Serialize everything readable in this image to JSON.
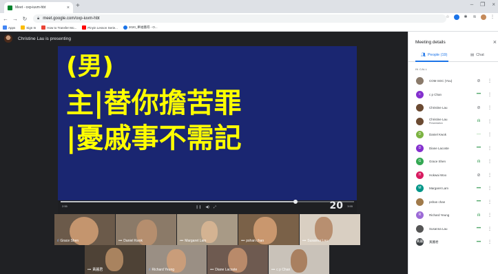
{
  "browser": {
    "tab_title": "Meet - oxp-iuvm-hbt",
    "tab_close": "×",
    "new_tab": "+",
    "url": "meet.google.com/oxp-iuvm-hbt",
    "bookmarks": [
      {
        "label": "Apps",
        "color": "#4285f4"
      },
      {
        "label": "Sign In",
        "color": "#fbbc04"
      },
      {
        "label": "How to Transfer Mo...",
        "color": "#ea4335"
      },
      {
        "label": "Pinyin Lesson Serie...",
        "color": "#ff0000"
      },
      {
        "label": "2020_牽福獲得 - O...",
        "color": "#1a73e8"
      }
    ],
    "window_buttons": [
      "–",
      "❐",
      "×"
    ]
  },
  "meet": {
    "presenting_text": "Christine Lau is presenting",
    "slide": {
      "line1": "(男)",
      "line2": "主|替你擔苦罪",
      "line3": "|憂戚事不需記",
      "page_number": "20",
      "time_elapsed": "2:55",
      "time_total": "3:55",
      "progress": 0.8
    },
    "tiles": [
      {
        "name": "Grace Shen",
        "bg": "#6b5a4a"
      },
      {
        "name": "Daniel Kwok",
        "bg": "#8b7a68"
      },
      {
        "name": "Margaret Lam",
        "bg": "#a89a86"
      },
      {
        "name": "pshan chan",
        "bg": "#7a6148"
      },
      {
        "name": "Susanna Lau",
        "bg": "#d9cfc2"
      },
      {
        "name": "黃麗君",
        "bg": "#4e4236"
      },
      {
        "name": "Richard Yeung",
        "bg": "#9a8f84"
      },
      {
        "name": "Diane Lacoste",
        "bg": "#6e5a50"
      },
      {
        "name": "c p Chan",
        "bg": "#c9c2b9"
      }
    ]
  },
  "panel": {
    "title": "Meeting details",
    "close": "×",
    "people_tab": "People (19)",
    "chat_tab": "Chat",
    "in_call": "IN CALL",
    "people": [
      {
        "name": "COM SGC (You)",
        "sub": "",
        "initial": "",
        "color": "#8a7a6a",
        "status": "mic-off"
      },
      {
        "name": "c p Chan",
        "sub": "",
        "initial": "c",
        "color": "#8430ce",
        "status": "dots"
      },
      {
        "name": "Christine Lau",
        "sub": "",
        "initial": "",
        "color": "#6b4a32",
        "status": "mic-off"
      },
      {
        "name": "Christine Lau",
        "sub": "Presentation",
        "initial": "",
        "color": "#6b4a32",
        "status": "talk"
      },
      {
        "name": "Daniel Kwok",
        "sub": "",
        "initial": "D",
        "color": "#7cb342",
        "status": "dots-faded"
      },
      {
        "name": "Diane Lacoste",
        "sub": "",
        "initial": "D",
        "color": "#8430ce",
        "status": "dots"
      },
      {
        "name": "Grace Shen",
        "sub": "",
        "initial": "G",
        "color": "#34a853",
        "status": "talk"
      },
      {
        "name": "Hokwai Woo",
        "sub": "",
        "initial": "H",
        "color": "#d81b60",
        "status": "mic-off"
      },
      {
        "name": "Margaret Lam",
        "sub": "",
        "initial": "M",
        "color": "#009688",
        "status": "dots"
      },
      {
        "name": "pshan chan",
        "sub": "",
        "initial": "",
        "color": "#a07a4a",
        "status": "dots"
      },
      {
        "name": "Richard Yeung",
        "sub": "",
        "initial": "R",
        "color": "#9c6ad6",
        "status": "talk"
      },
      {
        "name": "Susanna Lau",
        "sub": "",
        "initial": "",
        "color": "#555555",
        "status": "dots"
      },
      {
        "name": "黃麗君",
        "sub": "",
        "initial": "黃麗",
        "color": "#3c4043",
        "status": "dots"
      }
    ]
  }
}
